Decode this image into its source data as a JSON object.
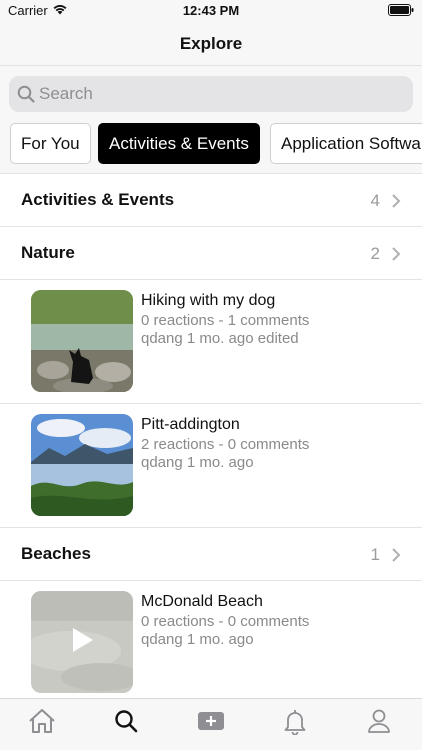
{
  "status_bar": {
    "carrier": "Carrier",
    "time": "12:43 PM"
  },
  "nav": {
    "title": "Explore"
  },
  "search": {
    "placeholder": "Search",
    "value": ""
  },
  "chips": [
    "For You",
    "Activities & Events",
    "Application Softwa"
  ],
  "active_chip": "Activities & Events",
  "sections": [
    {
      "title": "Activities & Events",
      "count": "4"
    },
    {
      "title": "Nature",
      "count": "2"
    },
    {
      "title": "Beaches",
      "count": "1"
    }
  ],
  "posts": [
    {
      "title": "Hiking with my dog",
      "meta": "0 reactions - 1 comments",
      "sub": "qdang  1 mo. ago edited"
    },
    {
      "title": "Pitt-addington",
      "meta": "2 reactions - 0 comments",
      "sub": "qdang  1 mo. ago"
    },
    {
      "title": "McDonald Beach",
      "meta": "0 reactions - 0 comments",
      "sub": "qdang  1 mo. ago"
    }
  ],
  "tabs": [
    "home-icon",
    "search-icon",
    "add-post-icon",
    "bell-icon",
    "profile-icon"
  ],
  "colors": {
    "accent": "#000000",
    "secondary_text": "#8a8a8a",
    "bar_background": "#f7f7f7"
  }
}
